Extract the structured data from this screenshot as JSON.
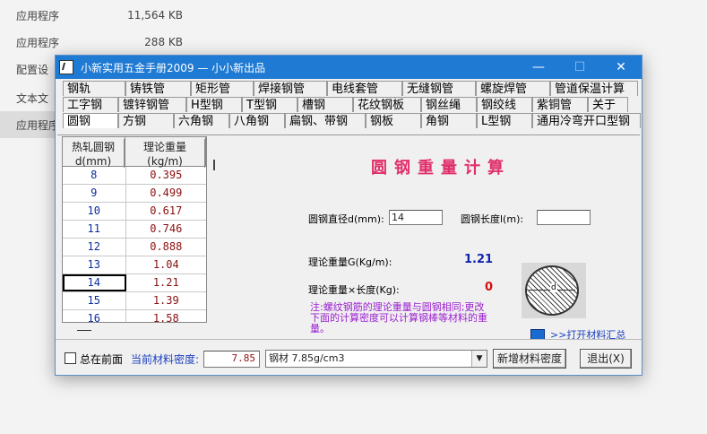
{
  "background": {
    "rows": [
      {
        "name": "应用程序",
        "size": "11,564 KB"
      },
      {
        "name": "应用程序",
        "size": "288 KB"
      },
      {
        "name": "配置设",
        "size": ""
      },
      {
        "name": "文本文",
        "size": ""
      },
      {
        "name": "应用程序",
        "size": ""
      }
    ]
  },
  "window": {
    "title": "小新实用五金手册2009 — 小小新出品",
    "min_glyph": "—",
    "max_glyph": "☐",
    "close_glyph": "✕"
  },
  "tabs": {
    "row1": [
      "钢轨",
      "铸铁管",
      "矩形管",
      "焊接钢管",
      "电线套管",
      "无缝钢管",
      "螺旋焊管",
      "管道保温计算"
    ],
    "row2": [
      "工字钢",
      "镀锌钢管",
      "H型钢",
      "T型钢",
      "槽钢",
      "花纹钢板",
      "钢丝绳",
      "钢绞线",
      "紫铜管",
      "关于"
    ],
    "row3": [
      "圆钢",
      "方钢",
      "六角钢",
      "八角钢",
      "扁钢、带钢",
      "钢板",
      "角钢",
      "L型钢",
      "通用冷弯开口型钢"
    ]
  },
  "table": {
    "header_d": "热轧圆钢\nd(mm)",
    "header_d1": "热轧圆钢",
    "header_d2": "d(mm)",
    "header_w1": "理论重量",
    "header_w2": "(kg/m)",
    "rows": [
      {
        "d": "8",
        "w": "0.395"
      },
      {
        "d": "9",
        "w": "0.499"
      },
      {
        "d": "10",
        "w": "0.617"
      },
      {
        "d": "11",
        "w": "0.746"
      },
      {
        "d": "12",
        "w": "0.888"
      },
      {
        "d": "13",
        "w": "1.04"
      },
      {
        "d": "14",
        "w": "1.21"
      },
      {
        "d": "15",
        "w": "1.39"
      },
      {
        "d": "16",
        "w": "1.58"
      }
    ]
  },
  "calc": {
    "title": "圆钢重量计算",
    "diameter_label": "圆钢直径d(mm):",
    "diameter_value": "14",
    "length_label": "圆钢长度l(m):",
    "length_value": "",
    "weight_label": "理论重量G(Kg/m):",
    "weight_value": "1.21",
    "weight_len_label": "理论重量×长度(Kg):",
    "weight_len_value": "0",
    "note": "注:螺纹钢筋的理论重量与圆钢相同;更改下面的计算密度可以计算钢棒等材料的重量。",
    "section_label": "d",
    "open_link": ">>打开材料汇总"
  },
  "bottom": {
    "always_front": "总在前面",
    "density_label": "当前材料密度:",
    "density_value": "7.85",
    "material_select": "钢材 7.85g/cm3",
    "add_button": "新增材料密度",
    "exit_button": "退出(X)"
  }
}
